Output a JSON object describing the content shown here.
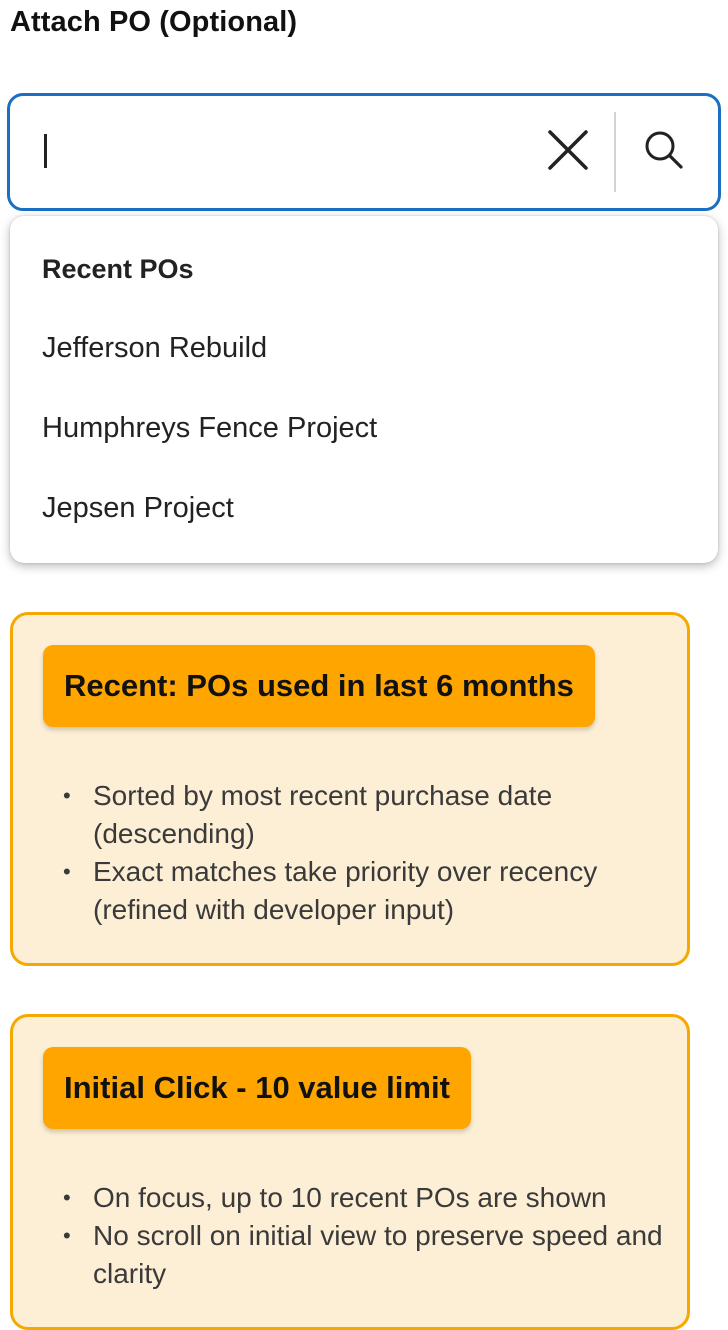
{
  "field": {
    "label": "Attach PO (Optional)"
  },
  "search": {
    "value": "",
    "placeholder": "",
    "clear_icon": "close-icon",
    "search_icon": "search-icon"
  },
  "dropdown": {
    "header": "Recent POs",
    "items": [
      {
        "label": "Jefferson Rebuild"
      },
      {
        "label": "Humphreys Fence Project"
      },
      {
        "label": "Jepsen Project"
      }
    ]
  },
  "notes": [
    {
      "badge": "Recent: POs used in last 6 months",
      "bullets": [
        "Sorted by most recent purchase date (descending)",
        "Exact matches take priority over recency (refined with developer input)"
      ]
    },
    {
      "badge": "Initial Click - 10 value limit",
      "bullets": [
        "On focus, up to 10 recent POs are shown",
        "No scroll on initial view to preserve speed and clarity"
      ]
    }
  ],
  "colors": {
    "focus_border": "#1a6fc4",
    "note_bg": "#fdefd5",
    "note_border": "#f5a800",
    "badge_bg": "#ffa500"
  }
}
